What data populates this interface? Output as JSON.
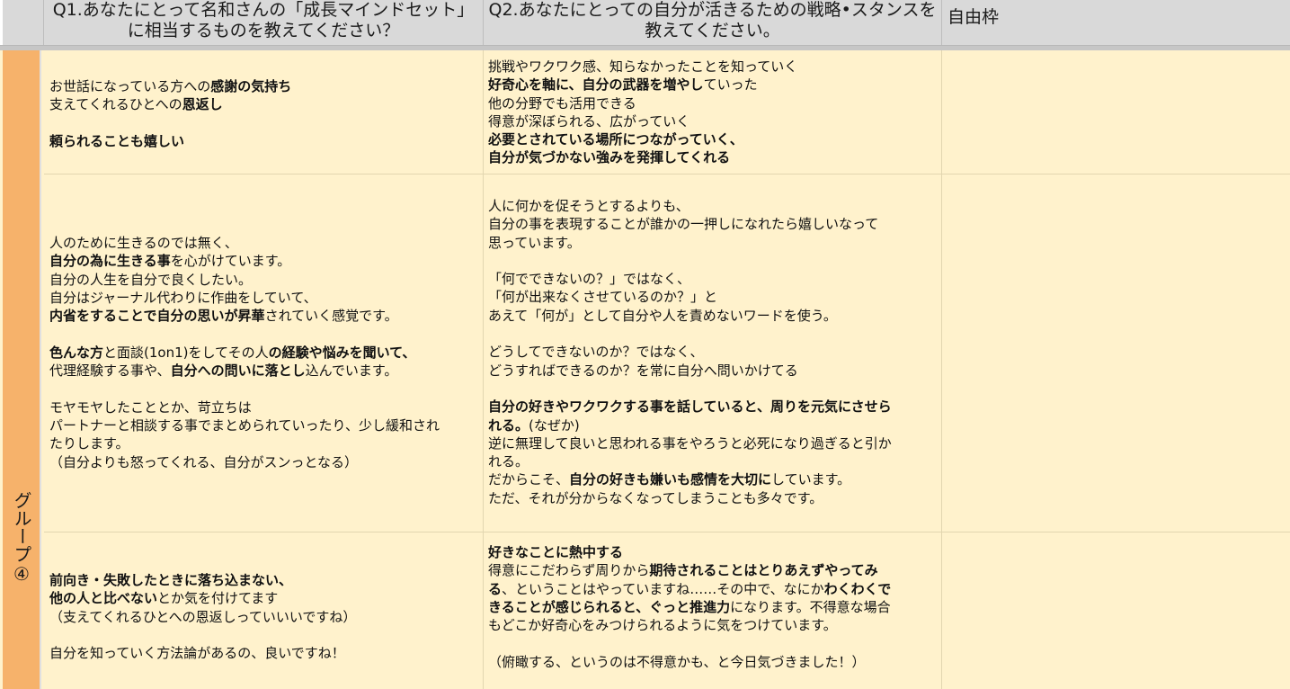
{
  "header": {
    "q1": "Q1.あなたにとって名和さんの「成長マインドセット」に相当するものを教えてください？",
    "q2": "Q2.あなたにとっての自分が活きるための戦略•スタンスを教えてください。",
    "free": "自由枠"
  },
  "group": {
    "label": "グループ④"
  },
  "colors": {
    "header_bg": "#d9d9d9",
    "row_bg": "#fff2cc",
    "group_bg": "#f6b26b"
  },
  "rows": [
    {
      "q1": [
        [
          [
            "お世話になっている方への",
            false
          ],
          [
            "感謝の気持ち",
            true
          ]
        ],
        [
          [
            "支えてくれるひとへの",
            false
          ],
          [
            "恩返し",
            true
          ]
        ],
        [],
        [
          [
            "頼られることも嬉しい",
            true
          ]
        ]
      ],
      "q2": [
        [
          [
            "挑戦やワクワク感、知らなかったことを知っていく",
            false
          ]
        ],
        [
          [
            "好奇心を軸に、自分の武器を増やし",
            true
          ],
          [
            "ていった",
            false
          ]
        ],
        [
          [
            "他の分野でも活用できる",
            false
          ]
        ],
        [
          [
            "得意が深ぼられる、広がっていく",
            false
          ]
        ],
        [
          [
            "必要とされている場所につながっていく、",
            true
          ]
        ],
        [
          [
            "自分が気づかない強みを発揮してくれる",
            true
          ]
        ]
      ]
    },
    {
      "q1": [
        [
          [
            "人のために生きるのでは無く、",
            false
          ]
        ],
        [
          [
            "自分の為に生きる事",
            true
          ],
          [
            "を心がけています。",
            false
          ]
        ],
        [
          [
            "自分の人生を自分で良くしたい。",
            false
          ]
        ],
        [
          [
            "自分はジャーナル代わりに作曲をしていて、",
            false
          ]
        ],
        [
          [
            "内省をすることで自分の思いが昇華",
            true
          ],
          [
            "されていく感覚です。",
            false
          ]
        ],
        [],
        [
          [
            "色んな方",
            true
          ],
          [
            "と面談(1on1)をしてその人",
            false
          ],
          [
            "の経験や悩みを聞いて、",
            true
          ]
        ],
        [
          [
            "代理経験する事や、",
            false
          ],
          [
            "自分への問いに落とし",
            true
          ],
          [
            "込んでいます。",
            false
          ]
        ],
        [],
        [
          [
            "モヤモヤしたこととか、苛立ちは",
            false
          ]
        ],
        [
          [
            "パートナーと相談する事でまとめられていったり、少し緩和され",
            false
          ]
        ],
        [
          [
            "たりします。",
            false
          ]
        ],
        [
          [
            "（自分よりも怒ってくれる、自分がスンっとなる）",
            false
          ]
        ]
      ],
      "q2": [
        [
          [
            "人に何かを促そうとするよりも、",
            false
          ]
        ],
        [
          [
            "自分の事を表現することが誰かの一押しになれたら嬉しいなって",
            false
          ]
        ],
        [
          [
            "思っています。",
            false
          ]
        ],
        [],
        [
          [
            "「何でできないの？」ではなく、",
            false
          ]
        ],
        [
          [
            "「何が出来なくさせているのか？」と",
            false
          ]
        ],
        [
          [
            "あえて「何が」として自分や人を責めないワードを使う。",
            false
          ]
        ],
        [],
        [
          [
            "どうしてできないのか？ではなく、",
            false
          ]
        ],
        [
          [
            "どうすればできるのか？を常に自分へ問いかけてる",
            false
          ]
        ],
        [],
        [
          [
            "自分の好きやワクワクする事を話していると、周りを元気にさせら",
            true
          ]
        ],
        [
          [
            "れる。",
            true
          ],
          [
            "(なぜか)",
            false
          ]
        ],
        [
          [
            "逆に無理して良いと思われる事をやろうと必死になり過ぎると引か",
            false
          ]
        ],
        [
          [
            "れる。",
            false
          ]
        ],
        [
          [
            "だからこそ、",
            false
          ],
          [
            "自分の好きも嫌いも感情を大切に",
            true
          ],
          [
            "しています。",
            false
          ]
        ],
        [
          [
            "ただ、それが分からなくなってしまうことも多々です。",
            false
          ]
        ]
      ]
    },
    {
      "q1": [
        [
          [
            "前向き・失敗したときに落ち込まない、",
            true
          ]
        ],
        [
          [
            "他の人と比べない",
            true
          ],
          [
            "とか気を付けてます",
            false
          ]
        ],
        [
          [
            "（支えてくれるひとへの恩返しっていいいですね）",
            false
          ]
        ],
        [],
        [
          [
            "自分を知っていく方法論があるの、良いですね！",
            false
          ]
        ]
      ],
      "q2": [
        [
          [
            "好きなことに熱中する",
            true
          ]
        ],
        [
          [
            "得意にこだわらず周りから",
            false
          ],
          [
            "期待されることはとりあえずやってみ",
            true
          ]
        ],
        [
          [
            "る",
            true
          ],
          [
            "、ということはやっていますね……その中で、なにか",
            false
          ],
          [
            "わくわくで",
            true
          ]
        ],
        [
          [
            "きることが感じられると、ぐっと推進力",
            true
          ],
          [
            "になります。不得意な場合",
            false
          ]
        ],
        [
          [
            "もどこか好奇心をみつけられるように気をつけています。",
            false
          ]
        ],
        [],
        [
          [
            "（俯瞰する、というのは不得意かも、と今日気づきました！）",
            false
          ]
        ]
      ]
    }
  ]
}
